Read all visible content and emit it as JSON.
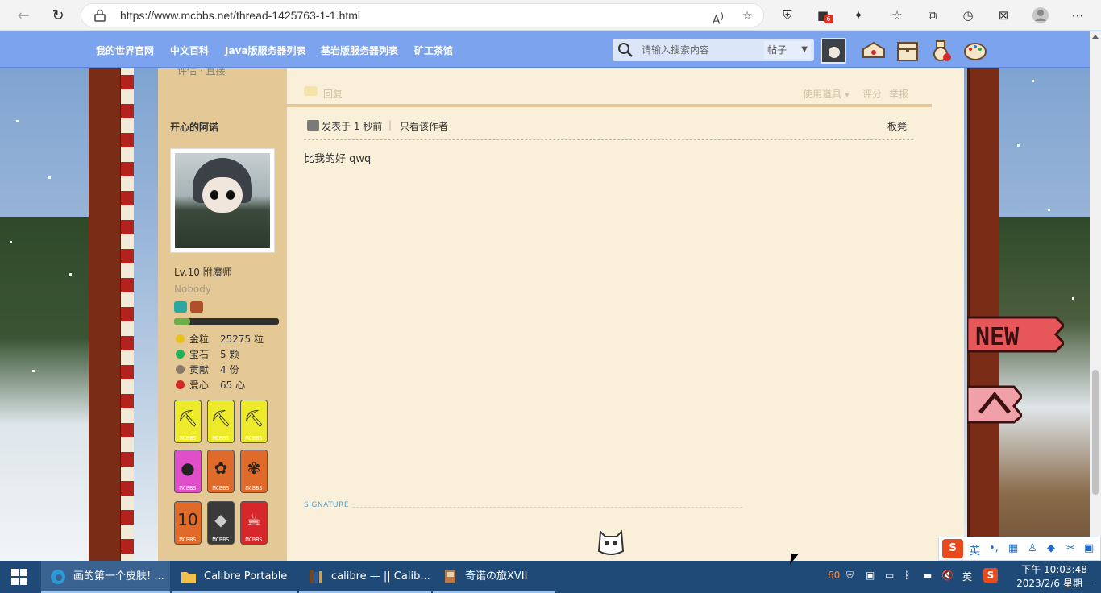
{
  "browser": {
    "url": "https://www.mcbbs.net/thread-1425763-1-1.html",
    "extension_badge": "6"
  },
  "forum_nav": {
    "items": [
      "我的世界官网",
      "中文百科",
      "Java版服务器列表",
      "基岩版服务器列表",
      "矿工茶馆"
    ]
  },
  "search": {
    "placeholder": "请输入搜索内容",
    "type": "帖子"
  },
  "previous_post": {
    "partial_text": "评估 · 直接",
    "reply_label": "回复",
    "use_tools": "使用道具",
    "rate": "评分",
    "report": "举报"
  },
  "author": {
    "name": "开心的阿诺",
    "level": "Lv.10 附魔师",
    "title": "Nobody",
    "xp_progress": 0.15,
    "stats": [
      {
        "key": "金粒",
        "value": "25275 粒",
        "color": "#e8c21a"
      },
      {
        "key": "宝石",
        "value": "5 颗",
        "color": "#1fb35a"
      },
      {
        "key": "贡献",
        "value": "4 份",
        "color": "#8a7a6a"
      },
      {
        "key": "爱心",
        "value": "65 心",
        "color": "#d6282a"
      }
    ],
    "medal_label": "MCBBS"
  },
  "post": {
    "posted_time": "发表于 1 秒前",
    "only_author": "只看该作者",
    "floor": "板凳",
    "content": "比我的好 qwq",
    "signature_label": "SIGNATURE"
  },
  "taskbar": {
    "tasks": [
      {
        "label": "画的第一个皮肤! ...",
        "icon": "edge-icon"
      },
      {
        "label": "Calibre Portable",
        "icon": "folder-icon"
      },
      {
        "label": "calibre — || Calib...",
        "icon": "calibre-icon"
      },
      {
        "label": "奇诺の旅XVII [EPU...",
        "icon": "book-icon"
      }
    ],
    "tray_temp": "60",
    "ime_lang": "英",
    "time": "下午 10:03:48",
    "date": "2023/2/6 星期一"
  },
  "ime": {
    "lang": "英"
  }
}
